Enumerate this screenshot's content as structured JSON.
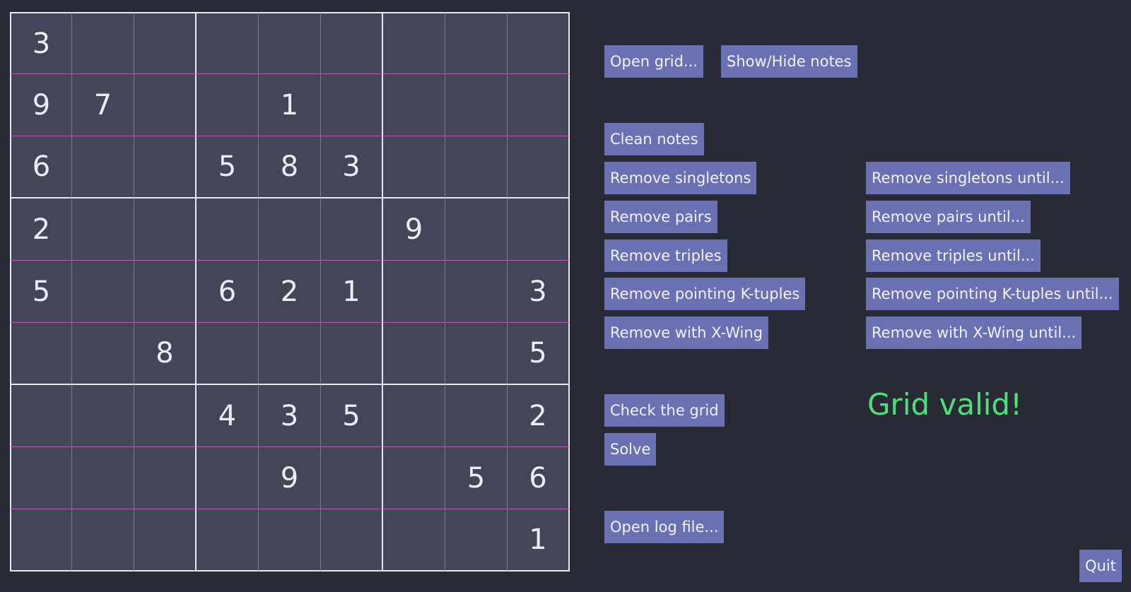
{
  "grid": [
    [
      "3",
      "",
      "",
      "",
      "",
      "",
      "",
      "",
      ""
    ],
    [
      "9",
      "7",
      "",
      "",
      "1",
      "",
      "",
      "",
      ""
    ],
    [
      "6",
      "",
      "",
      "5",
      "8",
      "3",
      "",
      "",
      ""
    ],
    [
      "2",
      "",
      "",
      "",
      "",
      "",
      "9",
      "",
      ""
    ],
    [
      "5",
      "",
      "",
      "6",
      "2",
      "1",
      "",
      "",
      "3"
    ],
    [
      "",
      "",
      "8",
      "",
      "",
      "",
      "",
      "",
      "5"
    ],
    [
      "",
      "",
      "",
      "4",
      "3",
      "5",
      "",
      "",
      "2"
    ],
    [
      "",
      "",
      "",
      "",
      "9",
      "",
      "",
      "5",
      "6"
    ],
    [
      "",
      "",
      "",
      "",
      "",
      "",
      "",
      "",
      "1"
    ]
  ],
  "buttons": {
    "open_grid": "Open grid...",
    "show_hide_notes": "Show/Hide notes",
    "clean_notes": "Clean notes",
    "remove_singletons": "Remove singletons",
    "remove_pairs": "Remove pairs",
    "remove_triples": "Remove triples",
    "remove_pointing": "Remove pointing K-tuples",
    "remove_xwing": "Remove with X-Wing",
    "remove_singletons_until": "Remove singletons until...",
    "remove_pairs_until": "Remove pairs until...",
    "remove_triples_until": "Remove triples until...",
    "remove_pointing_until": "Remove pointing K-tuples until...",
    "remove_xwing_until": "Remove with X-Wing until...",
    "check_grid": "Check the grid",
    "solve": "Solve",
    "open_log": "Open log file...",
    "quit": "Quit"
  },
  "status": {
    "message": "Grid valid!",
    "color": "#50e07a"
  },
  "colors": {
    "background": "#282a36",
    "cell": "#434559",
    "button": "#6a71b3",
    "box_border": "#e8e8f0",
    "cell_border": "#c052b3"
  }
}
